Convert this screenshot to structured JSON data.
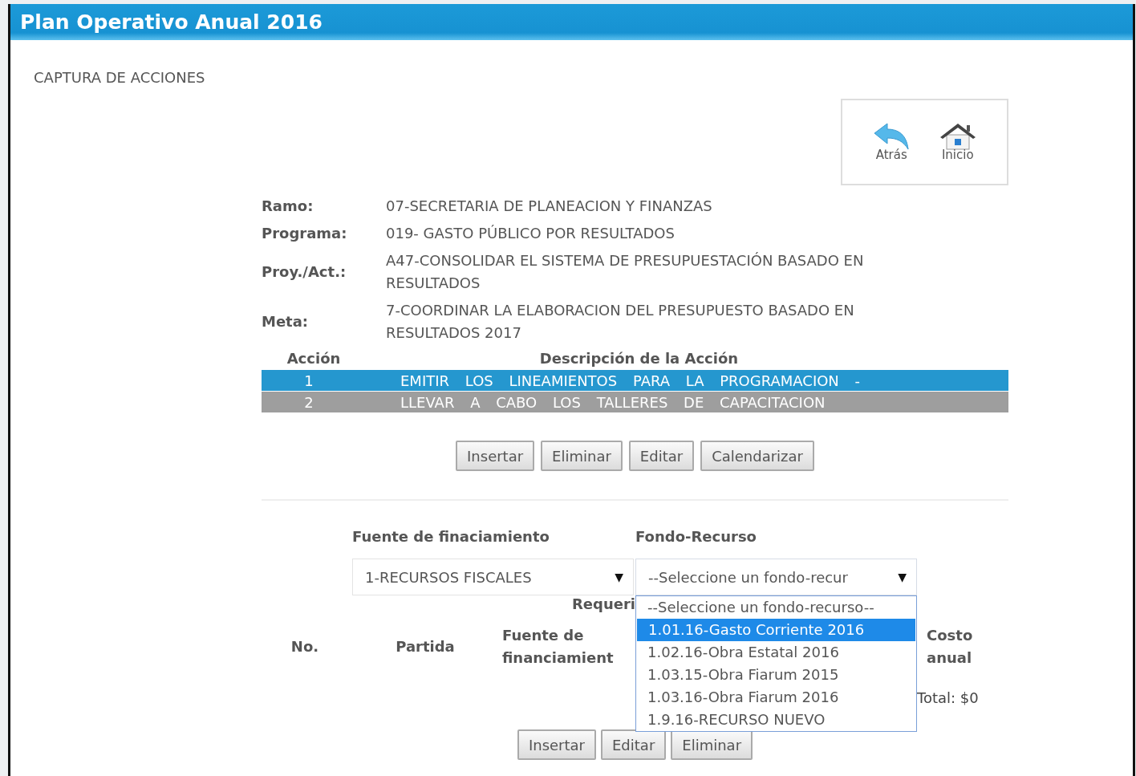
{
  "window": {
    "title": "Plan Operativo Anual 2016"
  },
  "section_title": "CAPTURA DE ACCIONES",
  "nav": [
    {
      "kind": "back",
      "label": "Atrás"
    },
    {
      "kind": "home",
      "label": "Inicio"
    }
  ],
  "info": [
    {
      "label": "Ramo:",
      "value": "07-SECRETARIA DE PLANEACION Y FINANZAS"
    },
    {
      "label": "Programa:",
      "value": "019- GASTO PÚBLICO POR RESULTADOS"
    },
    {
      "label": "Proy./Act.:",
      "value": "A47-CONSOLIDAR EL SISTEMA DE PRESUPUESTACIÓN BASADO EN RESULTADOS"
    },
    {
      "label": "Meta:",
      "value": "7-COORDINAR LA ELABORACION DEL PRESUPUESTO BASADO EN RESULTADOS 2017"
    }
  ],
  "actions": {
    "columns": [
      "Acción",
      "Descripción de la Acción"
    ],
    "rows": [
      {
        "number": "1",
        "description": "EMITIR LOS LINEAMIENTOS PARA LA PROGRAMACION -",
        "selected": true
      },
      {
        "number": "2",
        "description": "LLEVAR A CABO LOS TALLERES DE CAPACITACION",
        "selected": false
      }
    ],
    "buttons": [
      "Insertar",
      "Eliminar",
      "Editar",
      "Calendarizar"
    ]
  },
  "funding": {
    "fields": [
      {
        "label": "Fuente de finaciamiento",
        "value": "1-RECURSOS FISCALES",
        "expanded": false,
        "arrow": "▼"
      },
      {
        "label": "Fondo-Recurso",
        "value": "--Seleccione un fondo-recur",
        "expanded": true,
        "arrow": "▼",
        "options": [
          {
            "label": "--Seleccione un fondo-recurso--",
            "selected": false
          },
          {
            "label": "1.01.16-Gasto Corriente 2016",
            "selected": true
          },
          {
            "label": "1.02.16-Obra Estatal 2016",
            "selected": false
          },
          {
            "label": "1.03.15-Obra Fiarum 2015",
            "selected": false
          },
          {
            "label": "1.03.16-Obra Fiarum 2016",
            "selected": false
          },
          {
            "label": "1.9.16-RECURSO NUEVO",
            "selected": false
          }
        ]
      }
    ],
    "caption": "Requeri",
    "columns": [
      "No.",
      "Partida",
      "Fuente de financiamient",
      "Costo anual"
    ],
    "total": "Total: $0",
    "buttons": [
      "Insertar",
      "Editar",
      "Eliminar"
    ]
  }
}
